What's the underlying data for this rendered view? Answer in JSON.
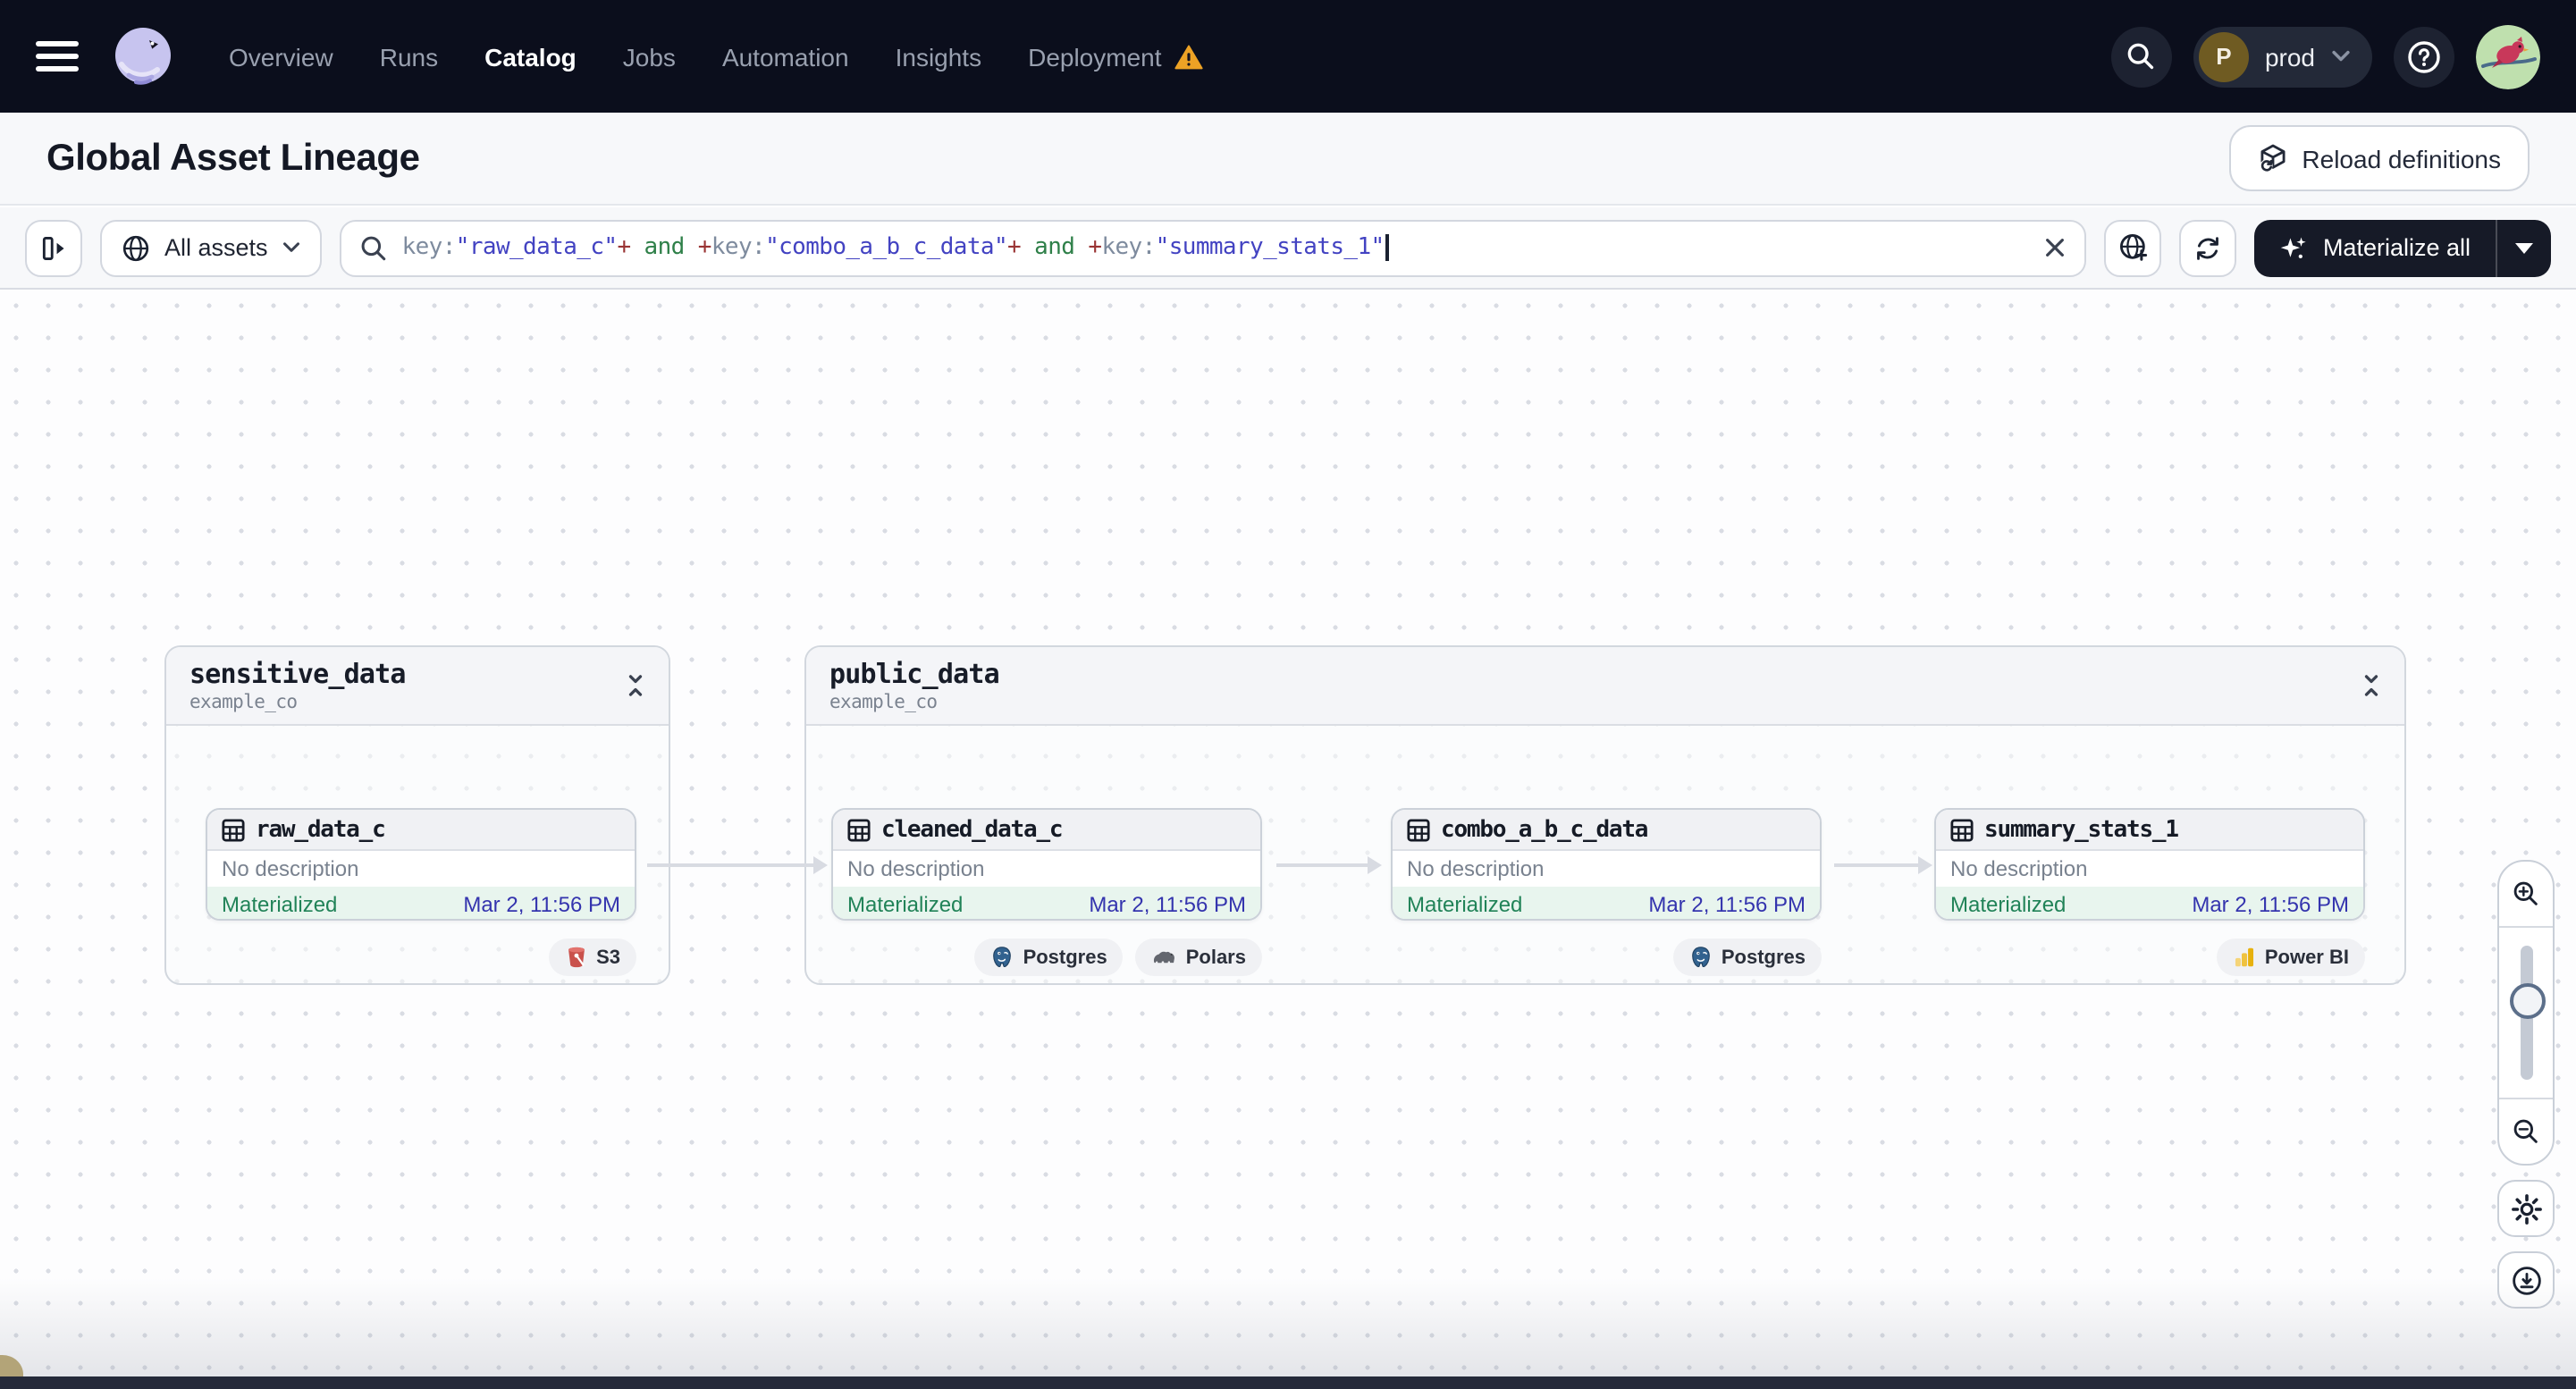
{
  "nav": {
    "menu_items": [
      {
        "label": "Overview"
      },
      {
        "label": "Runs"
      },
      {
        "label": "Catalog"
      },
      {
        "label": "Jobs"
      },
      {
        "label": "Automation"
      },
      {
        "label": "Insights"
      },
      {
        "label": "Deployment"
      }
    ],
    "active_item": "Catalog",
    "env_switcher": {
      "initial": "P",
      "label": "prod"
    }
  },
  "header": {
    "title": "Global Asset Lineage",
    "reload_button_label": "Reload definitions"
  },
  "toolbar": {
    "scope_label": "All assets",
    "materialize_label": "Materialize all",
    "query_segments": [
      {
        "text": "key:",
        "type": "attr"
      },
      {
        "text": "\"raw_data_c\"",
        "type": "value"
      },
      {
        "text": "+",
        "type": "op"
      },
      {
        "text": " and ",
        "type": "bool"
      },
      {
        "text": "+",
        "type": "op"
      },
      {
        "text": "key:",
        "type": "attr"
      },
      {
        "text": "\"combo_a_b_c_data\"",
        "type": "value"
      },
      {
        "text": "+",
        "type": "op"
      },
      {
        "text": " and ",
        "type": "bool"
      },
      {
        "text": "+",
        "type": "op"
      },
      {
        "text": "key:",
        "type": "attr"
      },
      {
        "text": "\"summary_stats_1\"",
        "type": "value"
      }
    ]
  },
  "graph": {
    "groups": [
      {
        "name": "sensitive_data",
        "repo": "example_co"
      },
      {
        "name": "public_data",
        "repo": "example_co"
      }
    ],
    "nodes": [
      {
        "name": "raw_data_c",
        "description": "No description",
        "status": "Materialized",
        "timestamp": "Mar 2, 11:56 PM",
        "badges": [
          {
            "label": "S3"
          }
        ]
      },
      {
        "name": "cleaned_data_c",
        "description": "No description",
        "status": "Materialized",
        "timestamp": "Mar 2, 11:56 PM",
        "badges": [
          {
            "label": "Postgres"
          },
          {
            "label": "Polars"
          }
        ]
      },
      {
        "name": "combo_a_b_c_data",
        "description": "No description",
        "status": "Materialized",
        "timestamp": "Mar 2, 11:56 PM",
        "badges": [
          {
            "label": "Postgres"
          }
        ]
      },
      {
        "name": "summary_stats_1",
        "description": "No description",
        "status": "Materialized",
        "timestamp": "Mar 2, 11:56 PM",
        "badges": [
          {
            "label": "Power BI"
          }
        ]
      }
    ]
  },
  "colors": {
    "nav_bg": "#0B0E1C",
    "accent_green": "#218358",
    "timestamp_blue": "#3434AE",
    "warning_amber": "#EDA225",
    "materialize_bg": "#161A27",
    "s3_red": "#C9514C",
    "postgres_blue": "#32628F",
    "powerbi_yellow": "#E7B10E"
  }
}
